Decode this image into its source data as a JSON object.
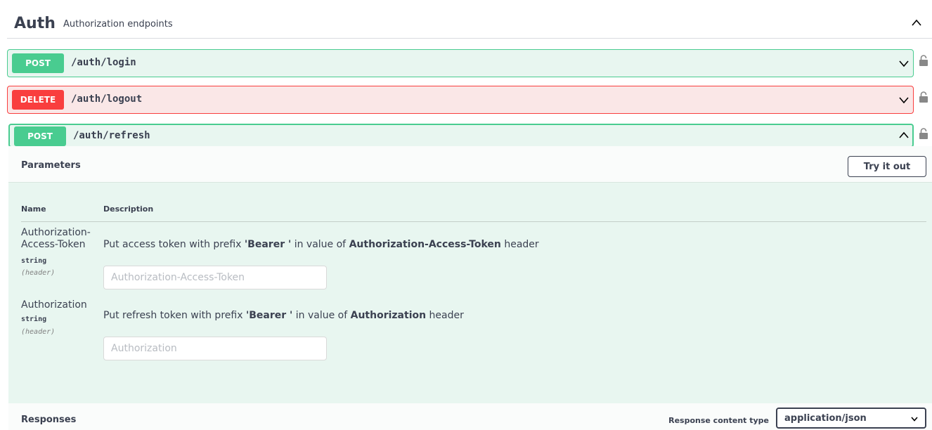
{
  "tag": {
    "name": "Auth",
    "description": "Authorization endpoints",
    "toggle_icon": "chevron-up-icon"
  },
  "operations": [
    {
      "method": "POST",
      "path": "/auth/login",
      "expanded": false
    },
    {
      "method": "DELETE",
      "path": "/auth/logout",
      "expanded": false
    },
    {
      "method": "POST",
      "path": "/auth/refresh",
      "expanded": true
    }
  ],
  "panel": {
    "parameters_title": "Parameters",
    "try_it_out_label": "Try it out",
    "columns": {
      "name": "Name",
      "description": "Description"
    },
    "params": [
      {
        "name_line1": "Authorization-",
        "name_line2": "Access-Token",
        "type": "string",
        "in": "(header)",
        "desc_prefix": "Put access token with prefix ",
        "desc_bold1": "'Bearer '",
        "desc_mid": " in value of ",
        "desc_bold2": "Authorization-Access-Token",
        "desc_suffix": " header",
        "placeholder": "Authorization-Access-Token"
      },
      {
        "name_line1": "Authorization",
        "type": "string",
        "in": "(header)",
        "desc_prefix": "Put refresh token with prefix ",
        "desc_bold1": "'Bearer '",
        "desc_mid": " in value of ",
        "desc_bold2": "Authorization",
        "desc_suffix": " header",
        "placeholder": "Authorization"
      }
    ],
    "responses_title": "Responses",
    "response_content_type_label": "Response content type",
    "response_content_type_value": "application/json"
  },
  "colors": {
    "post": "#49cc90",
    "delete": "#f93e3e",
    "text": "#3b4151"
  }
}
